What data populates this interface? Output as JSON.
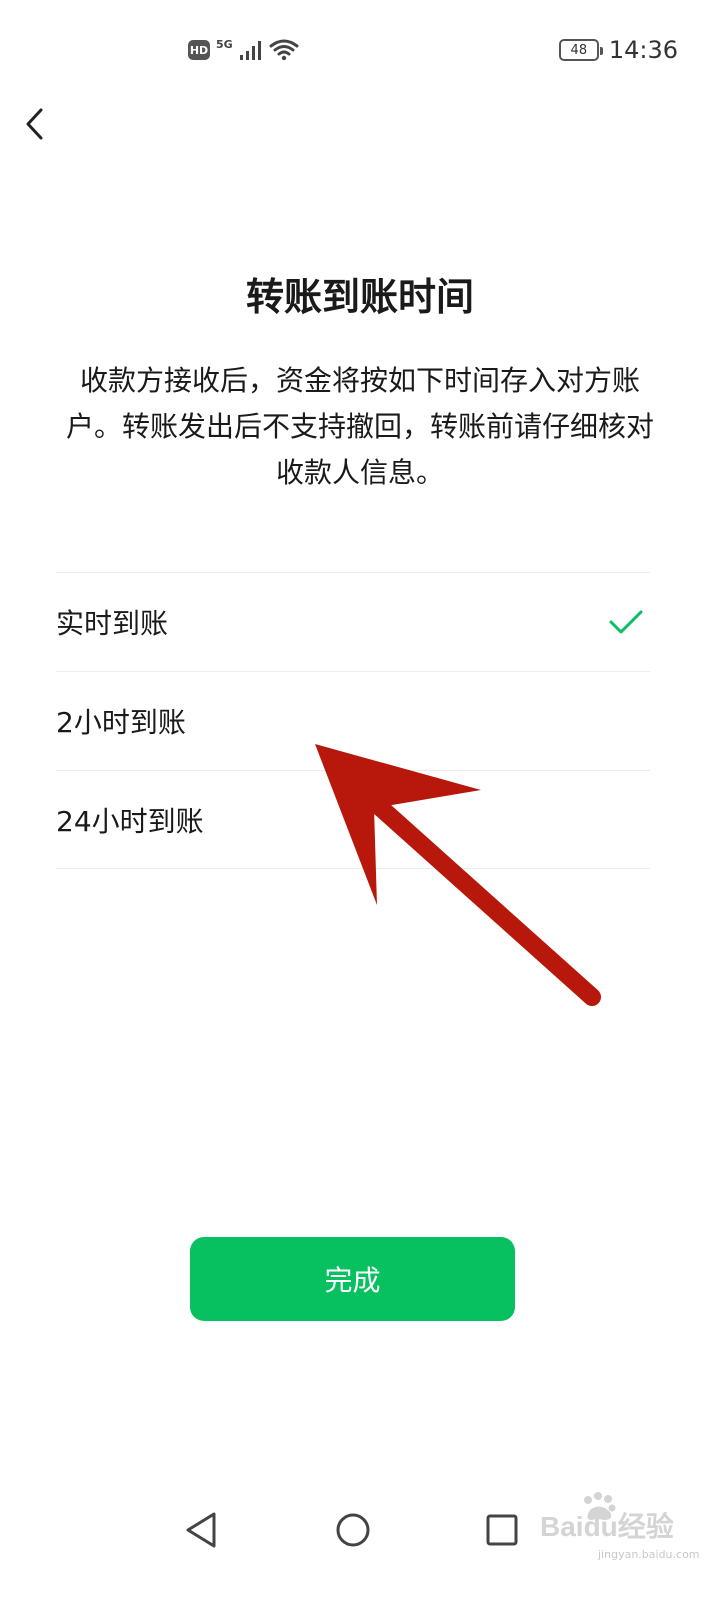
{
  "status_bar": {
    "hd_label": "HD",
    "network_label": "5G",
    "battery_level": "48",
    "time": "14:36"
  },
  "page": {
    "title": "转账到账时间",
    "description": "收款方接收后，资金将按如下时间存入对方账户。转账发出后不支持撤回，转账前请仔细核对收款人信息。"
  },
  "options": [
    {
      "label": "实时到账",
      "selected": true
    },
    {
      "label": "2小时到账",
      "selected": false
    },
    {
      "label": "24小时到账",
      "selected": false
    }
  ],
  "done_label": "完成",
  "watermark": {
    "text": "Baidu经验",
    "sub": "jingyan.baidu.com"
  },
  "colors": {
    "accent": "#07c160",
    "arrow": "#b8180c"
  }
}
